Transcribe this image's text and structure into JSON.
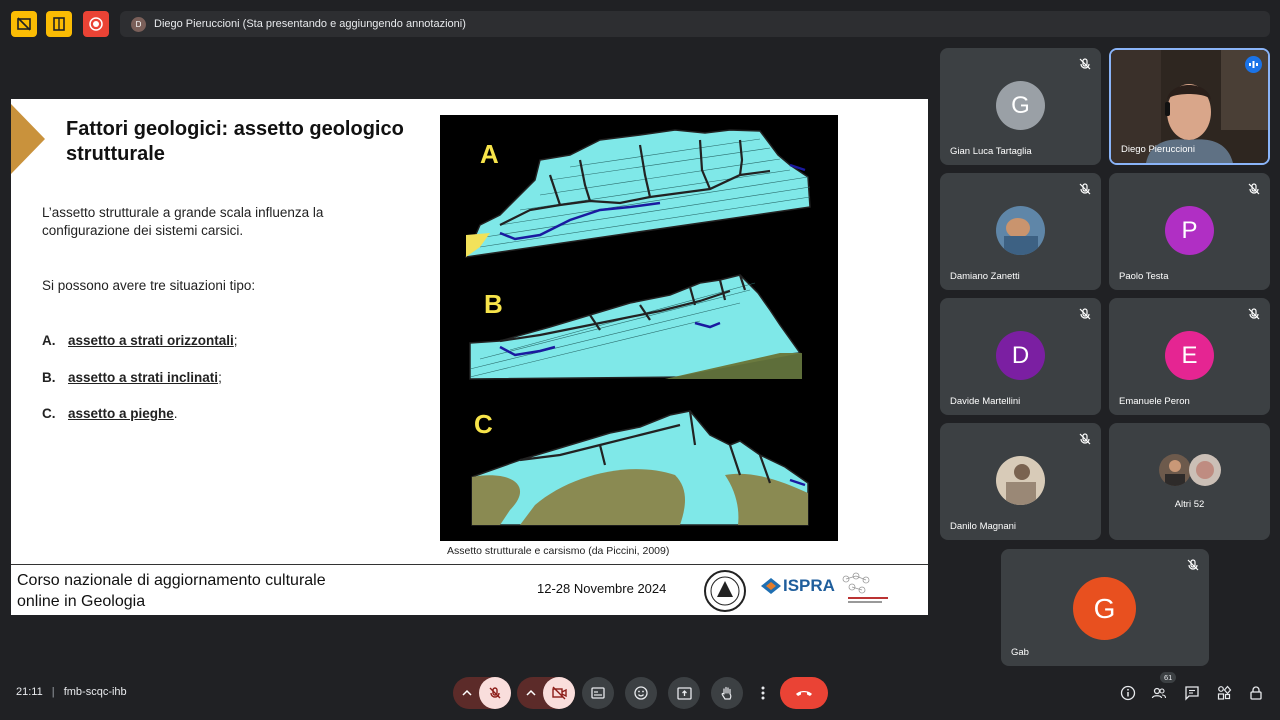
{
  "presenter_bar": {
    "avatar_letter": "D",
    "text": "Diego Pieruccioni (Sta presentando e aggiungendo annotazioni)"
  },
  "slide": {
    "title": "Fattori geologici: assetto geologico strutturale",
    "para1": "L’assetto strutturale a grande scala influenza la configurazione dei sistemi carsici.",
    "para2": "Si possono avere tre situazioni tipo:",
    "items": [
      {
        "letter": "A.",
        "text": "assetto a strati orizzontali",
        "end": ";"
      },
      {
        "letter": "B.",
        "text": "assetto a strati inclinati",
        "end": ";"
      },
      {
        "letter": "C.",
        "text": "assetto a pieghe",
        "end": "."
      }
    ],
    "figure_labels": [
      "A",
      "B",
      "C"
    ],
    "caption": "Assetto strutturale e carsismo (da Piccini, 2009)",
    "footer_line1": "Corso nazionale di aggiornamento culturale",
    "footer_line2": "online in Geologia",
    "footer_date": "12-28 Novembre 2024",
    "logo_ispra": "ISPRA"
  },
  "participants": [
    {
      "name": "Gian Luca Tartaglia",
      "letter": "G",
      "color": "#9aa0a6"
    },
    {
      "name": "Diego Pieruccioni",
      "letter": "",
      "color": "#4a3c33"
    },
    {
      "name": "Damiano Zanetti",
      "letter": "",
      "color": "#4a6a88"
    },
    {
      "name": "Paolo Testa",
      "letter": "P",
      "color": "#b02fc4"
    },
    {
      "name": "Davide Martellini",
      "letter": "D",
      "color": "#7b1fa2"
    },
    {
      "name": "Emanuele Peron",
      "letter": "E",
      "color": "#e52592"
    },
    {
      "name": "Danilo Magnani",
      "letter": "",
      "color": "#c9b9a3"
    },
    {
      "name": "Altri 52",
      "letter": "",
      "color": ""
    },
    {
      "name": "Gab",
      "letter": "G",
      "color": "#e8501f"
    }
  ],
  "bottom": {
    "time": "21:11",
    "meeting_code": "fmb-scqc-ihb",
    "people_count": "61"
  },
  "colors": {
    "accent_red": "#ea4335",
    "mic_off_bg": "#f9dedc",
    "yellow": "#fbbc04"
  }
}
